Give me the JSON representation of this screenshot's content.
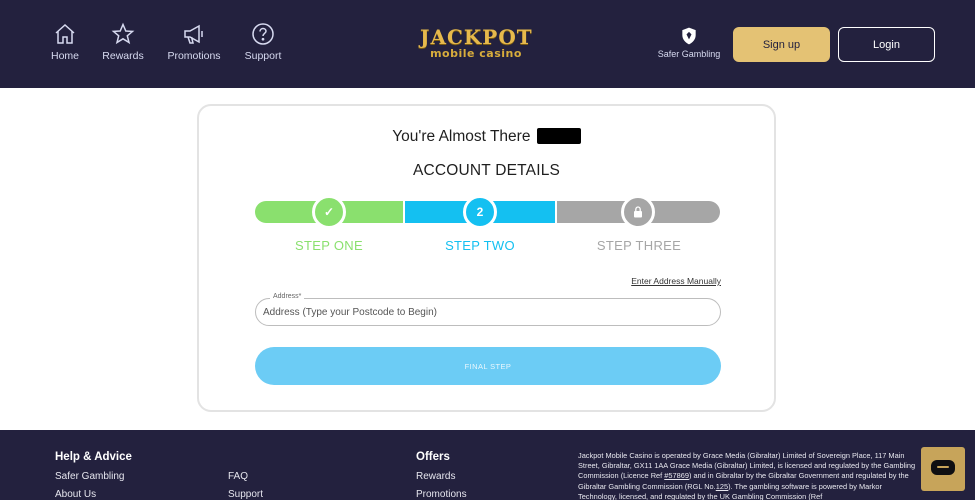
{
  "header": {
    "nav": [
      {
        "label": "Home",
        "icon": "home-icon"
      },
      {
        "label": "Rewards",
        "icon": "star-icon"
      },
      {
        "label": "Promotions",
        "icon": "megaphone-icon"
      },
      {
        "label": "Support",
        "icon": "question-icon"
      }
    ],
    "logo_top": "JACKPOT",
    "logo_bottom": "mobile casino",
    "safer_gambling_label": "Safer Gambling",
    "signup_label": "Sign up",
    "login_label": "Login"
  },
  "card": {
    "title": "You're Almost There",
    "subtitle": "ACCOUNT DETAILS",
    "steps": [
      {
        "label": "STEP ONE",
        "mark": "✓",
        "state": "complete",
        "color": "#8ae06e"
      },
      {
        "label": "STEP TWO",
        "mark": "2",
        "state": "current",
        "color": "#14c0f1"
      },
      {
        "label": "STEP THREE",
        "mark": "lock-icon",
        "state": "locked",
        "color": "#a6a6a6"
      }
    ],
    "manual_link": "Enter Address Manually",
    "address": {
      "label": "Address*",
      "placeholder": "Address (Type your Postcode to Begin)",
      "value": ""
    },
    "final_button": "FINAL STEP"
  },
  "footer": {
    "help_heading": "Help & Advice",
    "help_links": [
      "Safer Gambling",
      "About Us"
    ],
    "col2_links": [
      "FAQ",
      "Support"
    ],
    "offers_heading": "Offers",
    "offers_links": [
      "Rewards",
      "Promotions"
    ],
    "legal": {
      "p1": "Jackpot Mobile Casino is operated by Grace Media (Gibraltar) Limited of Sovereign Place, 117 Main Street, Gibraltar, GX11 1AA Grace Media (Gibraltar) Limited, is licensed and regulated by the Gambling Commission (Licence Ref ",
      "ref1": "#57869",
      "p2": ") and in Gibraltar by the Gibraltar Government and regulated by the Gibraltar Gambling Commission (RGL No.",
      "ref2": "125",
      "p3": "). The gambling software is powered by Markor Technology, licensed, and regulated by the UK Gambling Commission (Ref"
    }
  },
  "colors": {
    "header_bg": "#23213e",
    "signup_bg": "#e4c274",
    "step_complete": "#8ae06e",
    "step_current": "#14c0f1",
    "step_locked": "#a6a6a6",
    "final_button_bg": "#6cccf5",
    "chat_button_bg": "#c7a45a"
  },
  "chat_icon": "chat-bubble-icon"
}
